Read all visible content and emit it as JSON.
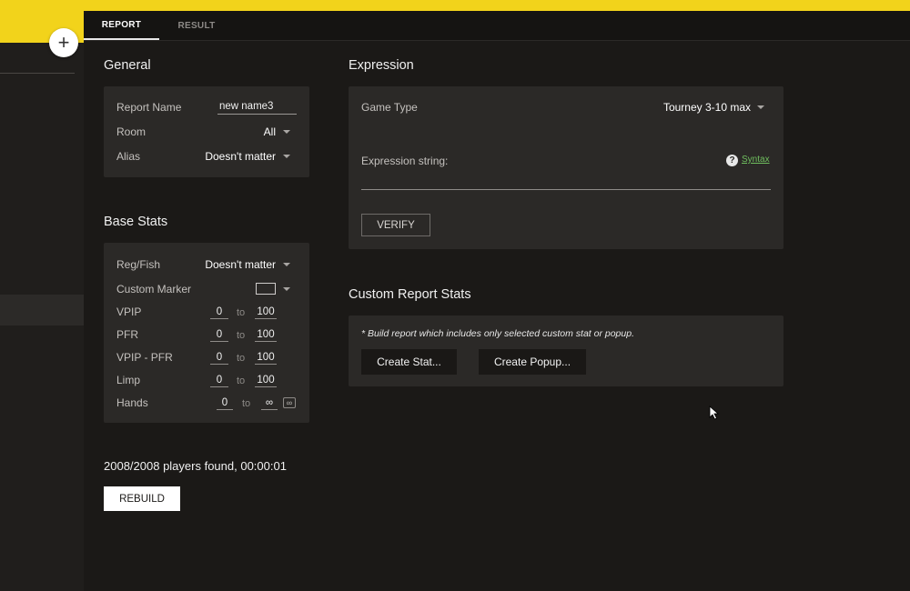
{
  "tabs": [
    {
      "label": "REPORT",
      "active": true
    },
    {
      "label": "RESULT",
      "active": false
    }
  ],
  "general": {
    "title": "General",
    "report_name_label": "Report Name",
    "report_name_value": "new name3",
    "room_label": "Room",
    "room_value": "All",
    "alias_label": "Alias",
    "alias_value": "Doesn't matter"
  },
  "base_stats": {
    "title": "Base Stats",
    "regfish_label": "Reg/Fish",
    "regfish_value": "Doesn't matter",
    "custom_marker_label": "Custom Marker",
    "ranges": [
      {
        "label": "VPIP",
        "from": "0",
        "to": "100"
      },
      {
        "label": "PFR",
        "from": "0",
        "to": "100"
      },
      {
        "label": "VPIP - PFR",
        "from": "0",
        "to": "100"
      },
      {
        "label": "Limp",
        "from": "0",
        "to": "100"
      },
      {
        "label": "Hands",
        "from": "0",
        "to": "∞"
      }
    ],
    "to_word": "to",
    "infinity_button": "∞"
  },
  "status": {
    "players_found": "2008/2008 players found, 00:00:01",
    "rebuild_label": "REBUILD"
  },
  "expression": {
    "title": "Expression",
    "game_type_label": "Game Type",
    "game_type_value": "Tourney 3-10 max",
    "expression_label": "Expression string:",
    "expression_value": "",
    "help_glyph": "?",
    "syntax_link": "Syntax",
    "verify_label": "VERIFY"
  },
  "custom_stats": {
    "title": "Custom Report Stats",
    "note": "* Build report which includes only selected custom stat or popup.",
    "create_stat_label": "Create Stat...",
    "create_popup_label": "Create Popup..."
  },
  "sidebar": {
    "add_glyph": "+"
  },
  "colors": {
    "accent_yellow": "#f2d31b",
    "background": "#1b1917",
    "card": "#2b2927",
    "link_green": "#6fbe5e"
  }
}
